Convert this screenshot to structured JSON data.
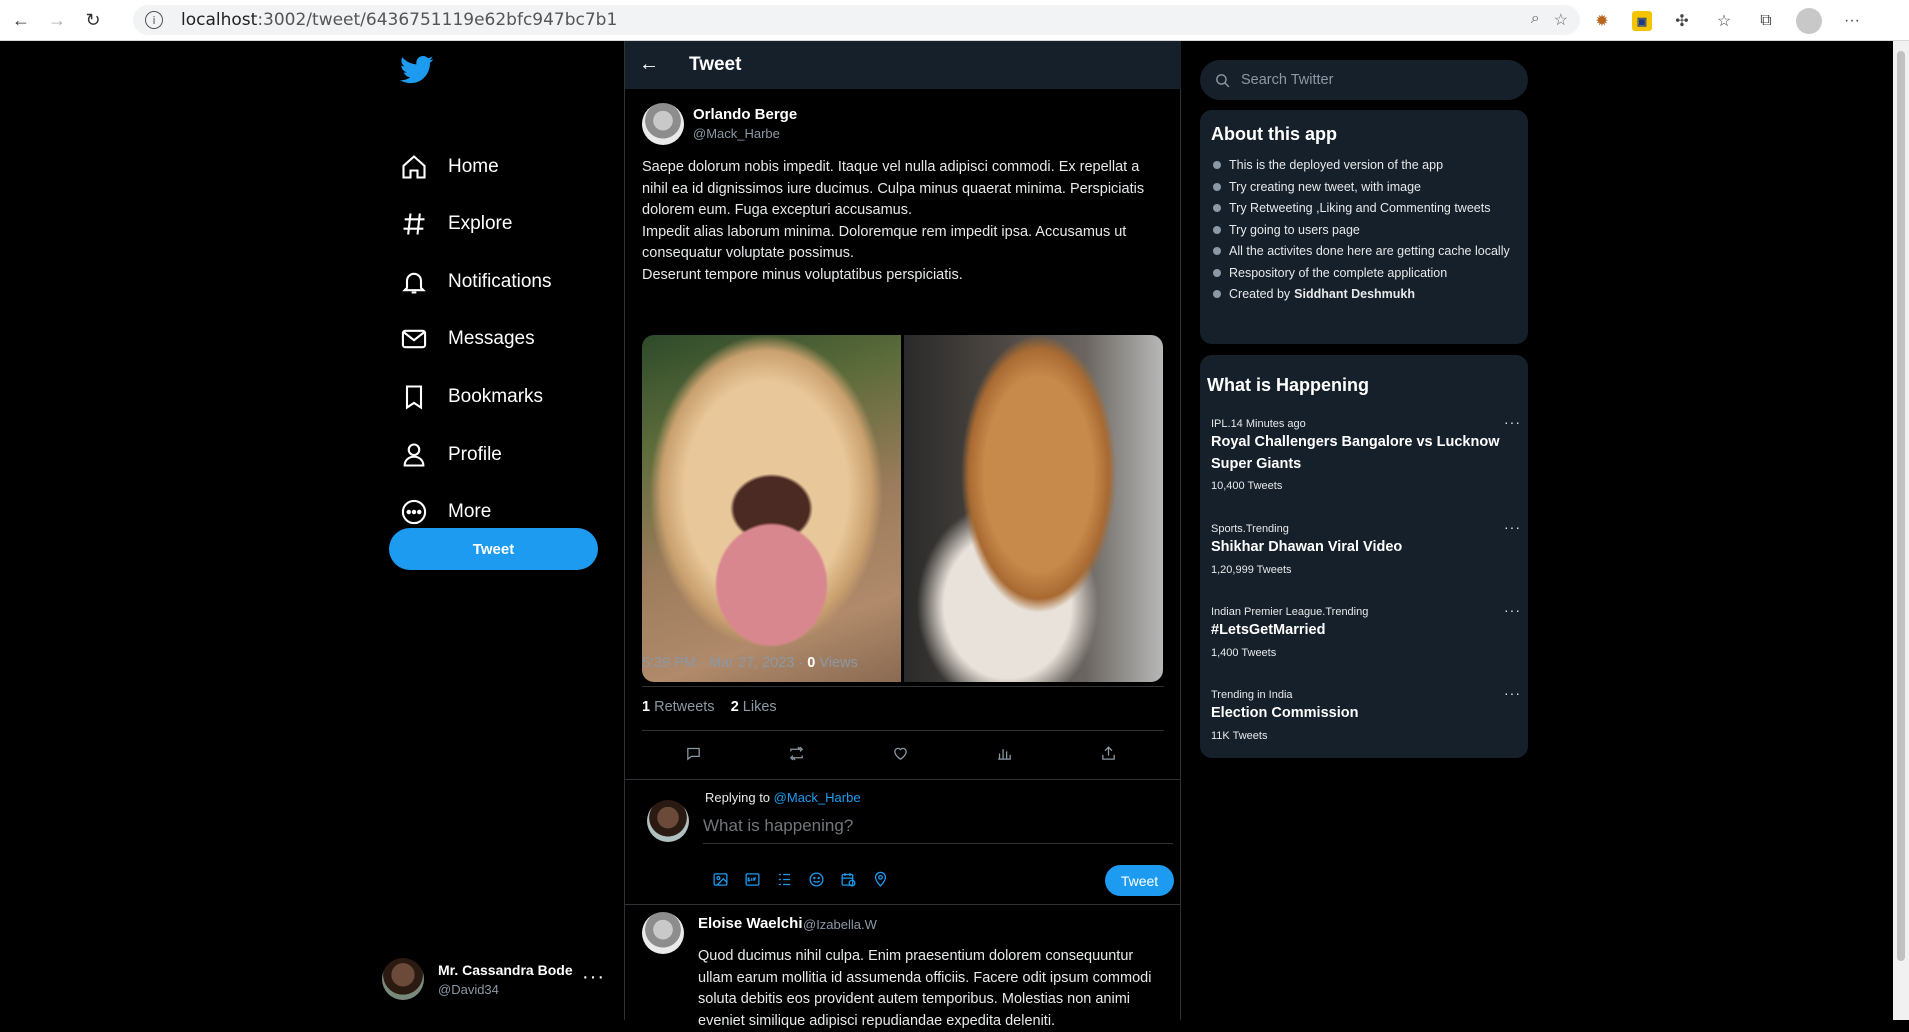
{
  "browser": {
    "url_host": "localhost",
    "url_path": ":3002/tweet/6436751119e62bfc947bc7b1",
    "info_icon": "i"
  },
  "sidebar": {
    "items": [
      {
        "label": "Home",
        "icon": "home-icon"
      },
      {
        "label": "Explore",
        "icon": "hashtag-icon"
      },
      {
        "label": "Notifications",
        "icon": "bell-icon"
      },
      {
        "label": "Messages",
        "icon": "mail-icon"
      },
      {
        "label": "Bookmarks",
        "icon": "bookmark-icon"
      },
      {
        "label": "Profile",
        "icon": "user-icon"
      },
      {
        "label": "More",
        "icon": "more-circle-icon"
      }
    ],
    "tweet_button": "Tweet",
    "current_user": {
      "name": "Mr. Cassandra Bode",
      "handle": "@David34",
      "menu": "···"
    }
  },
  "header": {
    "title": "Tweet",
    "back_icon": "←"
  },
  "post": {
    "author_name": "Orlando Berge",
    "author_handle": "@Mack_Harbe",
    "paragraphs": [
      "Saepe dolorum nobis impedit. Itaque vel nulla adipisci commodi. Ex repellat a nihil ea id dignissimos iure ducimus. Culpa minus quaerat minima. Perspiciatis dolorem eum. Fuga excepturi accusamus.",
      "Impedit alias laborum minima. Doloremque rem impedit ipsa. Accusamus ut consequatur voluptate possimus.",
      "Deserunt tempore minus voluptatibus perspiciatis."
    ],
    "timestamp": "5:39 PM · Mar 27, 2023 ·",
    "views_count": "0",
    "views_label": "Views",
    "retweets_count": "1",
    "retweets_label": "Retweets",
    "likes_count": "2",
    "likes_label": "Likes"
  },
  "reply": {
    "replying_to_label": "Replying to",
    "replying_to_handle": "@Mack_Harbe",
    "placeholder": "What is happening?",
    "button": "Tweet"
  },
  "comment": {
    "author_name": "Eloise Waelchi",
    "author_handle": "@Izabella.W",
    "text": "Quod ducimus nihil culpa. Enim praesentium dolorem consequuntur ullam earum mollitia id assumenda officiis. Facere odit ipsum commodi soluta debitis eos provident autem temporibus. Molestias non animi eveniet similique adipisci repudiandae expedita deleniti."
  },
  "search": {
    "placeholder": "Search Twitter"
  },
  "about": {
    "title": "About this app",
    "items": [
      "This is the deployed version of the app",
      "Try creating new tweet, with image",
      "Try Retweeting ,Liking and Commenting tweets",
      "Try going to users page",
      "All the activites done here are getting cache locally",
      "Respository of the complete application"
    ],
    "created_by_label": "Created by",
    "created_by_name": "Siddhant Deshmukh"
  },
  "happening": {
    "title": "What is Happening",
    "trends": [
      {
        "category": "IPL.14 Minutes ago",
        "topic": "Royal Challengers Bangalore vs Lucknow Super Giants",
        "count": "10,400 Tweets"
      },
      {
        "category": "Sports.Trending",
        "topic": "Shikhar Dhawan Viral Video",
        "count": "1,20,999 Tweets"
      },
      {
        "category": "Indian Premier League.Trending",
        "topic": "#LetsGetMarried",
        "count": "1,400 Tweets"
      },
      {
        "category": "Trending in India",
        "topic": "Election Commission",
        "count": "11K Tweets"
      }
    ],
    "more_icon": "···"
  },
  "colors": {
    "accent": "#1d9bf0",
    "panel": "#16202a",
    "header": "#15202b"
  }
}
